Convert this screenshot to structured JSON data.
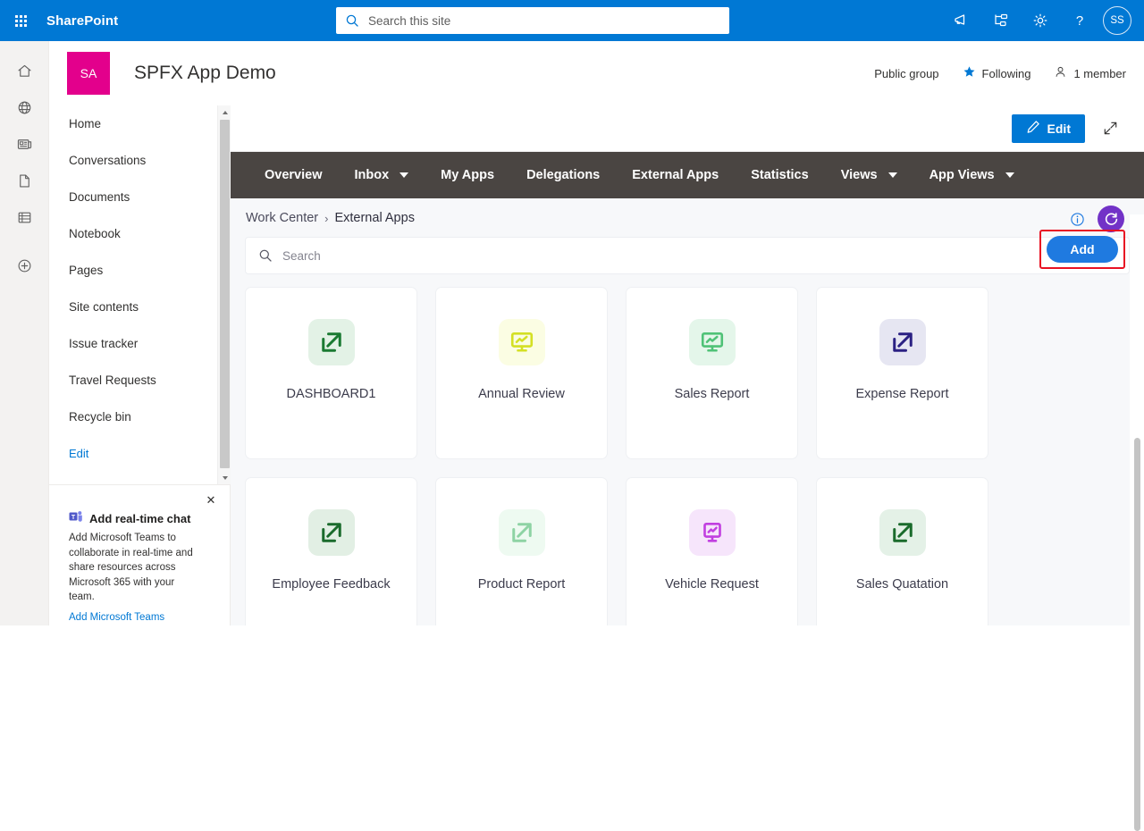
{
  "suite": {
    "brand": "SharePoint",
    "waffle_name": "app-launcher",
    "search": {
      "placeholder": "Search this site",
      "value": ""
    },
    "icons": [
      {
        "name": "megaphone-icon",
        "label": "Announcements"
      },
      {
        "name": "diagnostics-icon",
        "label": "Diagnostics"
      },
      {
        "name": "gear-icon",
        "label": "Settings"
      },
      {
        "name": "help-icon",
        "label": "Help"
      }
    ],
    "avatar_initials": "SS"
  },
  "rail": {
    "items": [
      {
        "name": "home-icon",
        "label": "Home"
      },
      {
        "name": "globe-icon",
        "label": "Sites"
      },
      {
        "name": "news-icon",
        "label": "News"
      },
      {
        "name": "file-icon",
        "label": "Files"
      },
      {
        "name": "lists-icon",
        "label": "Lists"
      },
      {
        "name": "create-icon",
        "label": "Create"
      }
    ]
  },
  "site": {
    "logo_initials": "SA",
    "title": "SPFX App Demo",
    "privacy": "Public group",
    "following": "Following",
    "members": "1 member"
  },
  "commandbar": {
    "edit_label": "Edit",
    "expand_label": "Full screen"
  },
  "leftnav": {
    "items": [
      {
        "label": "Home"
      },
      {
        "label": "Conversations"
      },
      {
        "label": "Documents"
      },
      {
        "label": "Notebook"
      },
      {
        "label": "Pages"
      },
      {
        "label": "Site contents"
      },
      {
        "label": "Issue tracker"
      },
      {
        "label": "Travel Requests"
      },
      {
        "label": "Recycle bin"
      }
    ],
    "edit_label": "Edit"
  },
  "teams_promo": {
    "title": "Add real-time chat",
    "body": "Add Microsoft Teams to collaborate in real-time and share resources across Microsoft 365 with your team.",
    "link": "Add Microsoft Teams",
    "close_label": "✕"
  },
  "appnav": {
    "items": [
      {
        "label": "Overview",
        "caret": false
      },
      {
        "label": "Inbox",
        "caret": true
      },
      {
        "label": "My Apps",
        "caret": false
      },
      {
        "label": "Delegations",
        "caret": false
      },
      {
        "label": "External Apps",
        "caret": false
      },
      {
        "label": "Statistics",
        "caret": false
      },
      {
        "label": "Views",
        "caret": true
      },
      {
        "label": "App Views",
        "caret": true
      }
    ]
  },
  "webpart": {
    "breadcrumb": {
      "root": "Work Center",
      "separator": "›",
      "current": "External Apps"
    },
    "search": {
      "placeholder": "Search",
      "value": ""
    },
    "add_label": "Add",
    "info_label": "Information",
    "refresh_label": "Refresh",
    "highlight_color": "#e81123",
    "tiles": [
      {
        "label": "DASHBOARD1",
        "icon": "external-link-icon",
        "fg": "#1a7a32",
        "bg": "#e3f2e6"
      },
      {
        "label": "Annual Review",
        "icon": "dashboard-icon",
        "fg": "#d4e024",
        "bg": "#fbfde3"
      },
      {
        "label": "Sales Report",
        "icon": "dashboard-icon",
        "fg": "#4fc277",
        "bg": "#e4f6ea"
      },
      {
        "label": "Expense Report",
        "icon": "external-link-icon",
        "fg": "#2b2183",
        "bg": "#e6e6f2"
      },
      {
        "label": "Employee Feedback",
        "icon": "external-link-icon",
        "fg": "#1a6b2c",
        "bg": "#e2efe4"
      },
      {
        "label": "Product Report",
        "icon": "external-link-icon",
        "fg": "#8ed3a4",
        "bg": "#eefaf1"
      },
      {
        "label": "Vehicle Request",
        "icon": "dashboard-icon",
        "fg": "#c13fe0",
        "bg": "#f6e5fb"
      },
      {
        "label": "Sales Quatation",
        "icon": "external-link-icon",
        "fg": "#1a6b2c",
        "bg": "#e4f1e7"
      }
    ]
  }
}
